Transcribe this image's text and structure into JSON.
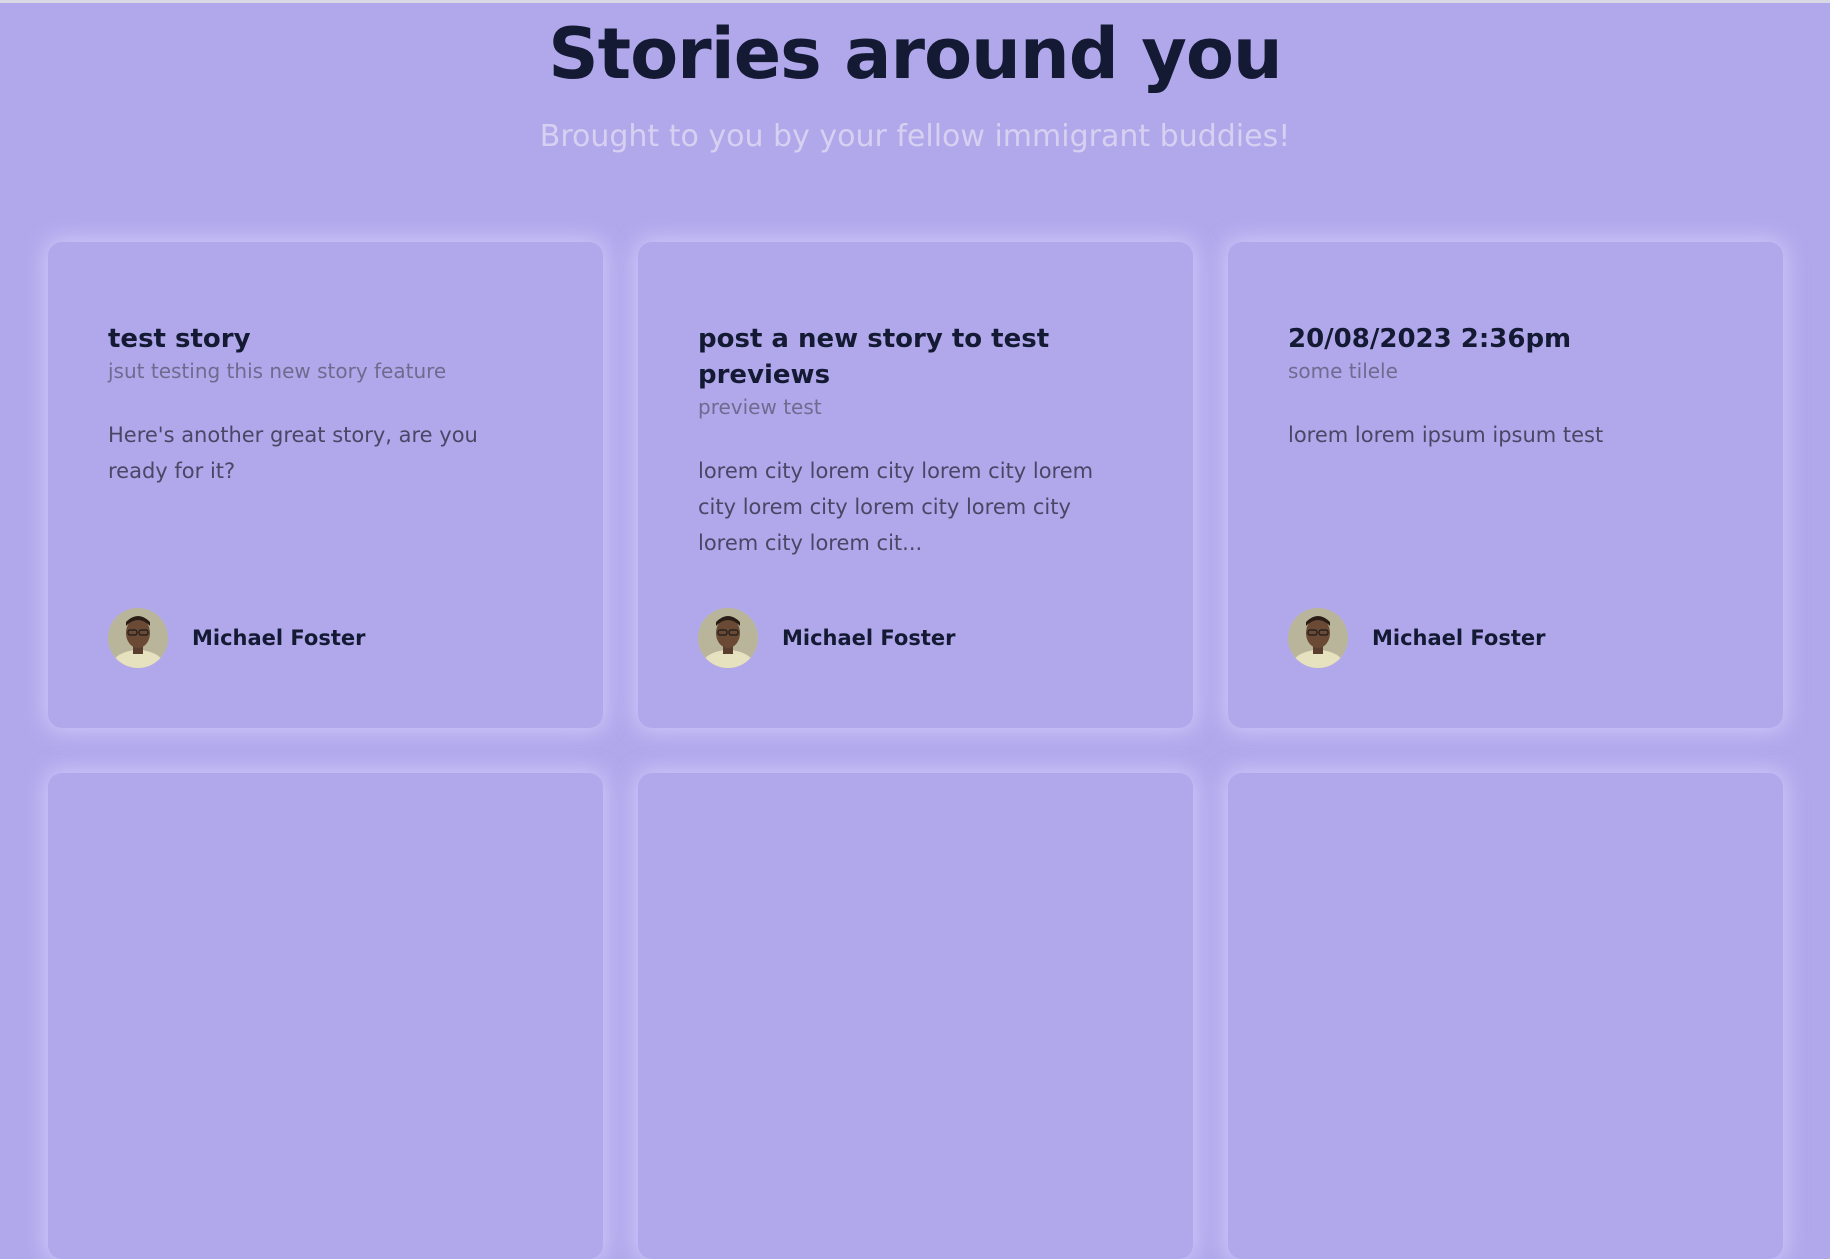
{
  "header": {
    "title": "Stories around you",
    "subtitle": "Brought to you by your fellow immigrant buddies!"
  },
  "stories": [
    {
      "title": "test story",
      "subtitle": "jsut testing this new story feature",
      "body": "Here's another great story, are you ready for it?",
      "author": "Michael Foster"
    },
    {
      "title": "post a new story to test previews",
      "subtitle": "preview test",
      "body": "lorem city lorem city lorem city lorem city lorem city lorem city lorem city lorem city lorem cit...",
      "author": "Michael Foster"
    },
    {
      "title": "20/08/2023 2:36pm",
      "subtitle": "some tilele",
      "body": "lorem lorem ipsum ipsum test",
      "author": "Michael Foster"
    }
  ],
  "colors": {
    "page_background": "#b0a8eb",
    "heading": "#141a33",
    "subtitle": "#d7d0f0"
  }
}
